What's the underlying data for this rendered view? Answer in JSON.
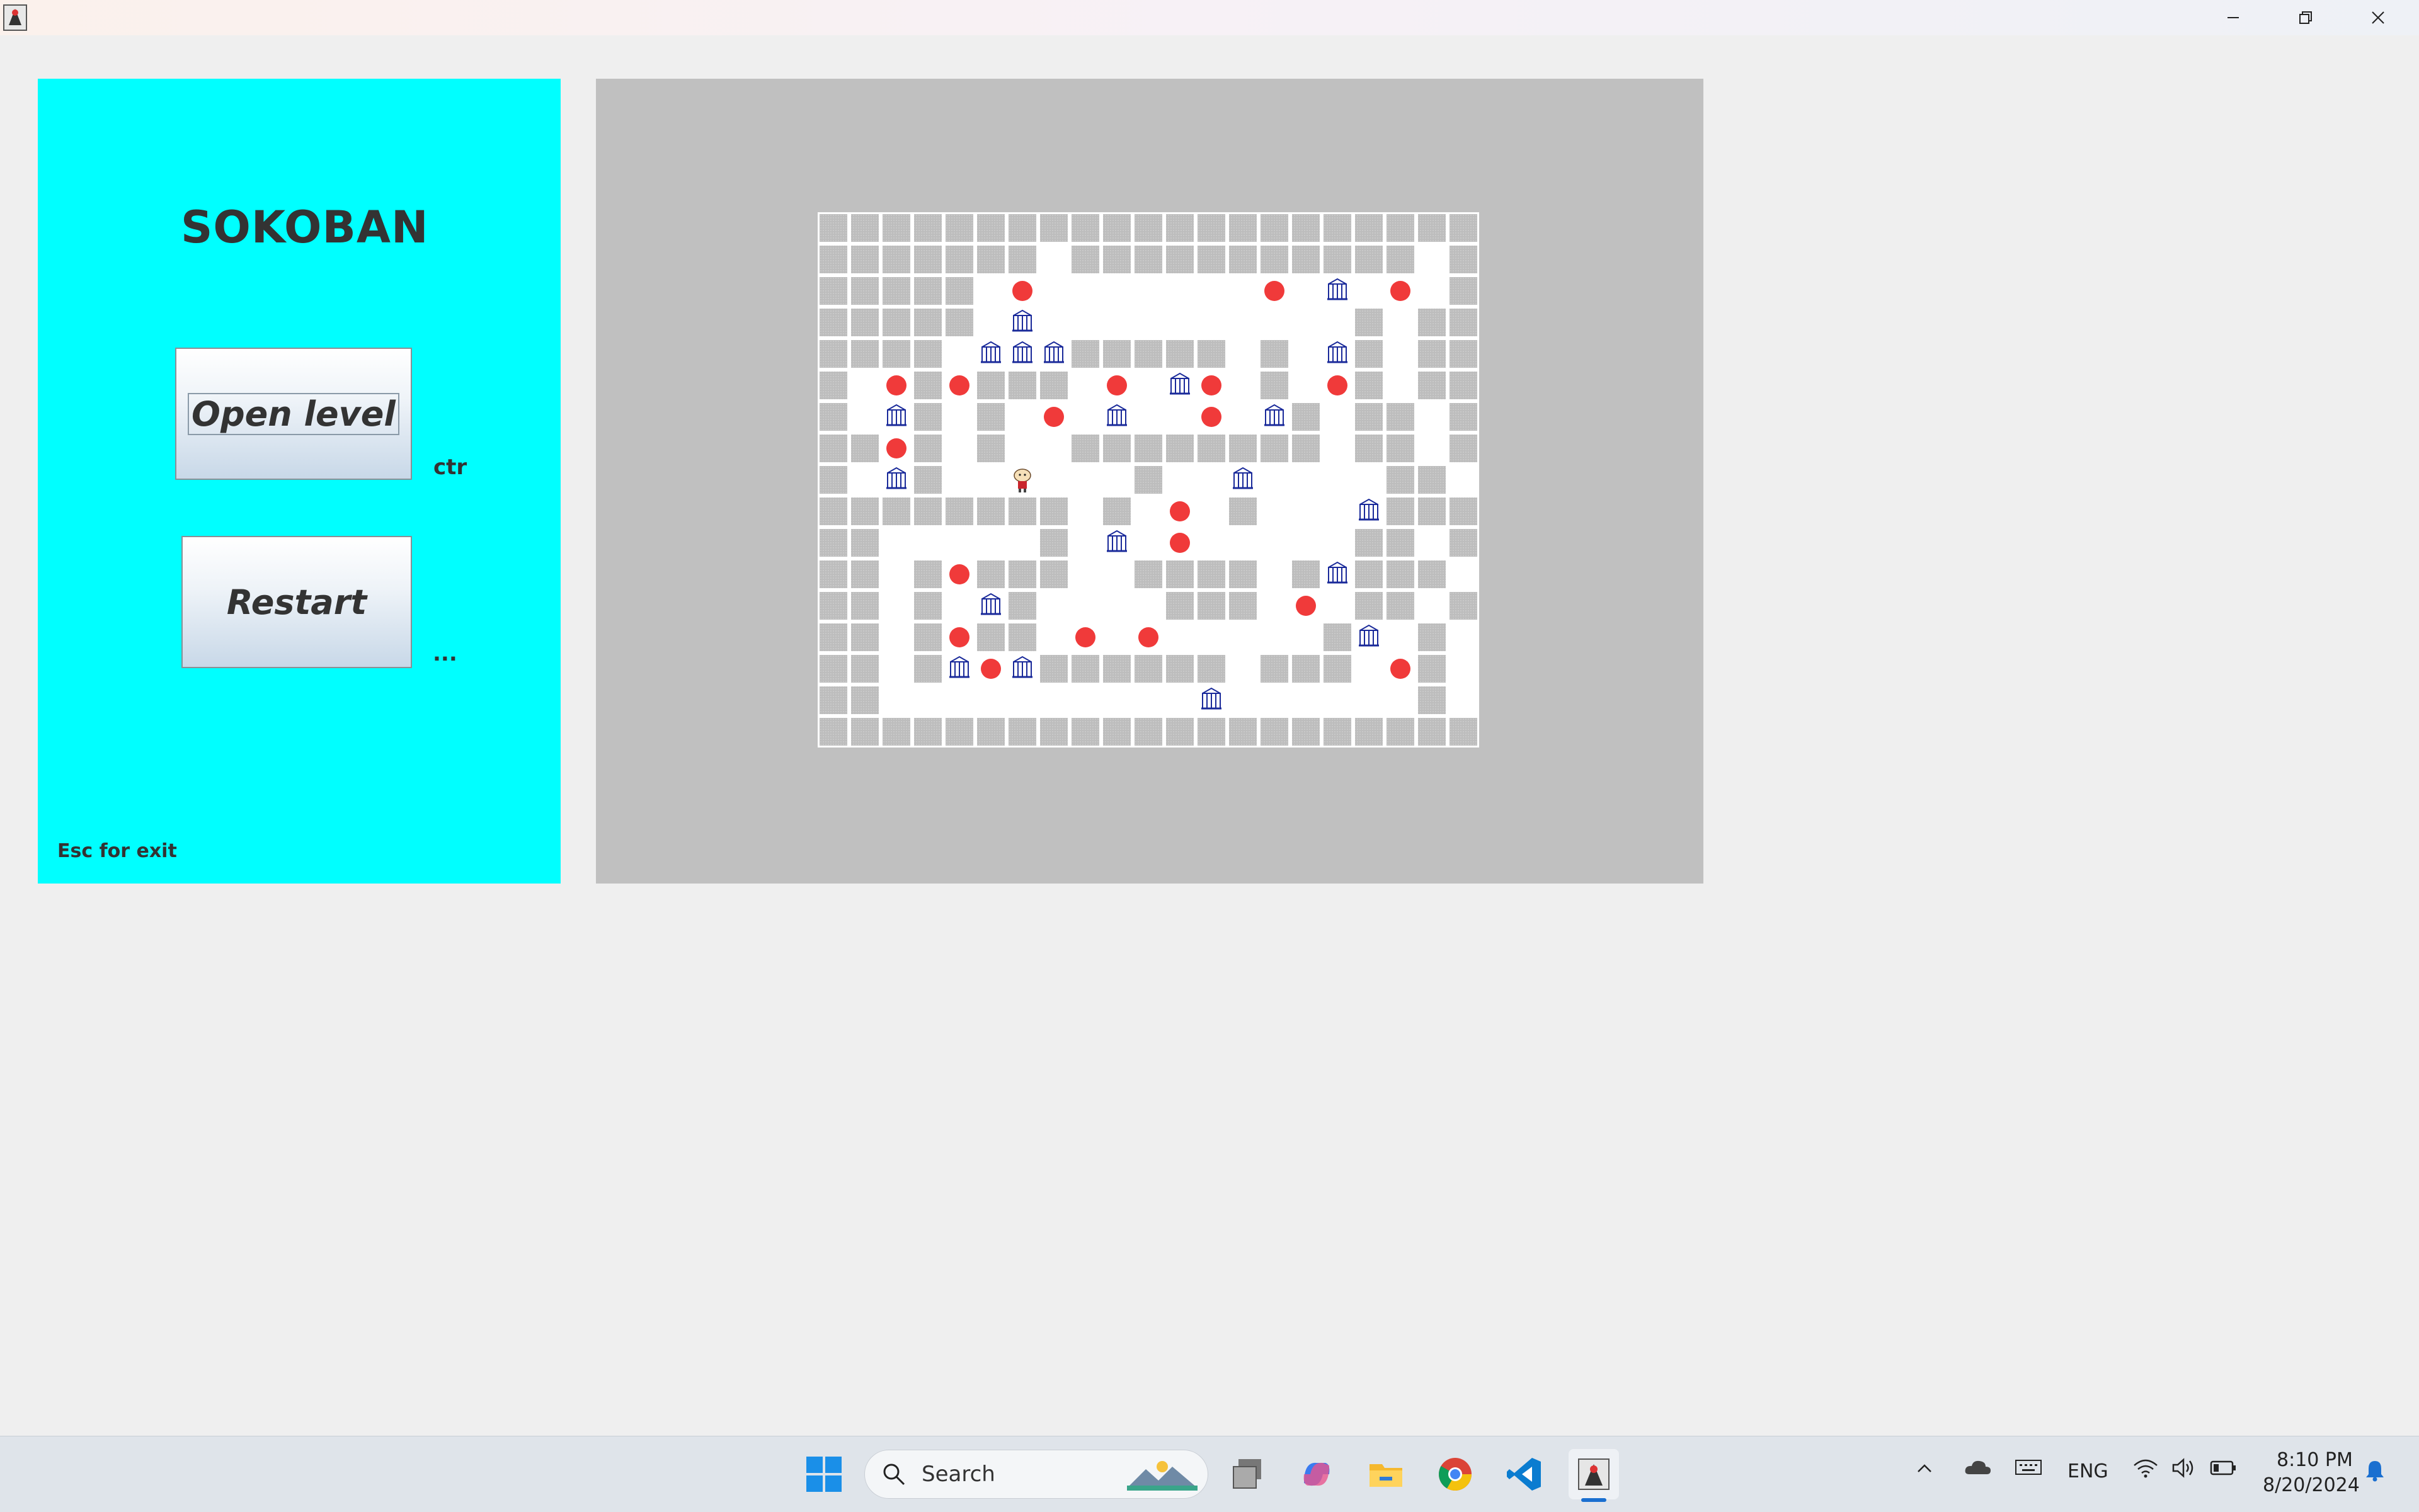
{
  "window": {
    "icon": "java-duke-icon"
  },
  "left_panel": {
    "title": "SOKOBAN",
    "open_button": "Open level",
    "open_hint": "ctr",
    "restart_button": "Restart",
    "restart_hint": "...",
    "exit_hint": "Esc for exit",
    "background_color": "#00ffff"
  },
  "board": {
    "legend": {
      "#": "wall",
      ".": "floor",
      "o": "goal",
      "b": "box",
      "@": "player"
    },
    "rows": [
      "#####################",
      "#######.###########.#",
      "#####.o.......o b.o.#",
      "#####.b..........#.##",
      "####.bbb#####.#.b#.##",
      "#.o#o###.o.bo.#.o#.##",
      "#.b#.#.o.b..o.b#.##.#",
      "##o#.#..########.##.#",
      "#.b#..@...#..b....##.#",
      "########.#.o.#...b###",
      "##.....#.b.o.....##.#",
      "##.#o###..####.#b###",
      "##.#.b#....###.o.##.#",
      "##.#o##.o.o.....#b.#",
      "##.#bob######.###.o#",
      "##..........b......#",
      "#####################"
    ]
  },
  "taskbar": {
    "search_placeholder": "Search",
    "language": "ENG",
    "time": "8:10 PM",
    "date": "8/20/2024",
    "icons": [
      "start-icon",
      "search-icon",
      "task-view-icon",
      "copilot-icon",
      "file-explorer-icon",
      "chrome-icon",
      "vscode-icon",
      "java-app-icon"
    ],
    "tray_icons": [
      "chevron-up-icon",
      "onedrive-icon",
      "keyboard-icon",
      "wifi-icon",
      "volume-icon",
      "battery-icon",
      "notification-icon"
    ]
  }
}
